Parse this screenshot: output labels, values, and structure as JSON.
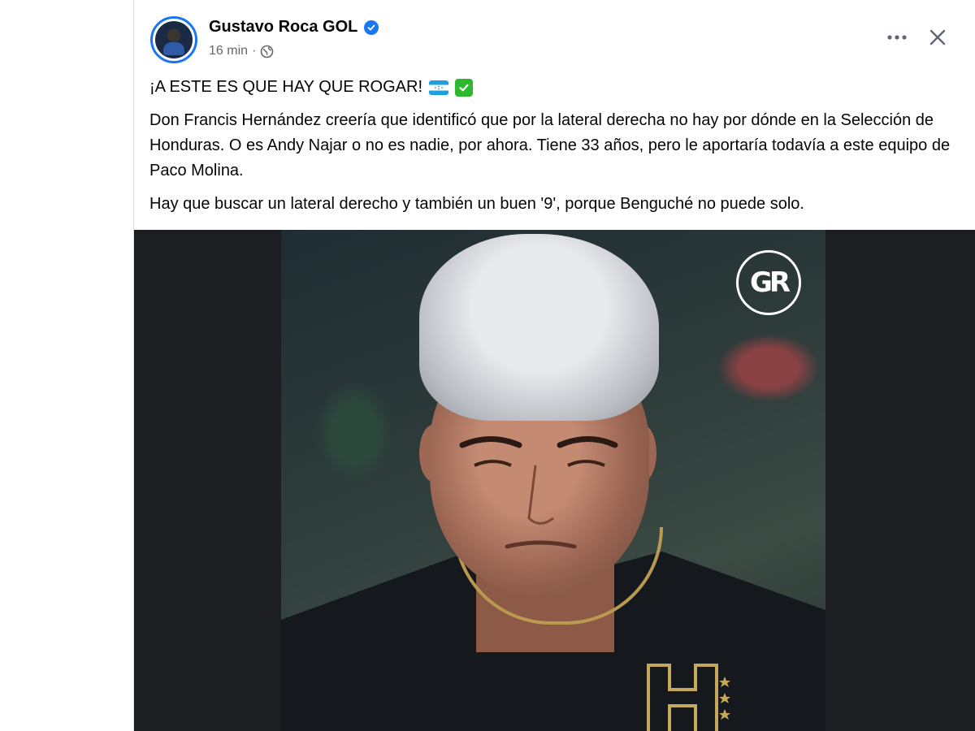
{
  "post": {
    "author": {
      "name": "Gustavo Roca GOL",
      "verified": true
    },
    "meta": {
      "time": "16 min",
      "separator": "·",
      "audience_icon": "globe-icon"
    },
    "actions": {
      "more_icon": "more-horizontal-icon",
      "close_icon": "close-icon"
    },
    "text": {
      "headline": "¡A ESTE ES QUE HAY QUE ROGAR!",
      "headline_emojis": [
        "honduras-flag-icon",
        "check-mark-icon"
      ],
      "paragraph_1": "Don Francis Hernández creería que identificó que por la lateral derecha no hay por dónde en la Selección de Honduras. O es Andy Najar o no es nadie, por ahora. Tiene 33 años, pero le aportaría todavía a este equipo de Paco Molina.",
      "paragraph_2": "Hay que buscar un lateral derecho y también un buen '9', porque Benguché no puede solo."
    },
    "media": {
      "description_icon": "player-photo",
      "watermark": "GR",
      "jersey_crest": "H"
    }
  },
  "colors": {
    "verified_blue": "#1877f2",
    "meta_gray": "#65676b",
    "media_background": "#1c1e21",
    "jersey_gold": "#b99a4f"
  }
}
